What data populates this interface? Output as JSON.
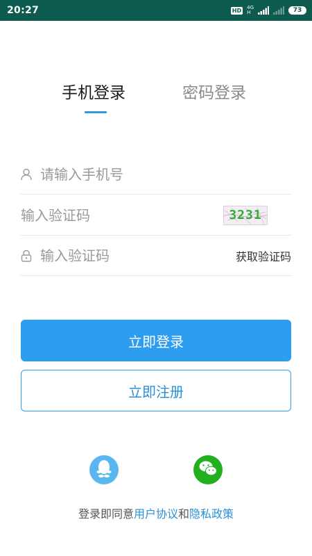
{
  "status_bar": {
    "time": "20:27",
    "hd_badge": "HD",
    "network_top": "4G",
    "network_bottom": "H",
    "battery": "73"
  },
  "tabs": [
    {
      "label": "手机登录",
      "active": true
    },
    {
      "label": "密码登录",
      "active": false
    }
  ],
  "form": {
    "phone_placeholder": "请输入手机号",
    "captcha_placeholder": "输入验证码",
    "captcha_code": "3231",
    "sms_placeholder": "输入验证码",
    "get_code_label": "获取验证码"
  },
  "buttons": {
    "login": "立即登录",
    "register": "立即注册"
  },
  "social": {
    "qq_icon": "qq-icon",
    "wechat_icon": "wechat-icon"
  },
  "agreement": {
    "prefix": "登录即同意",
    "user_agreement": "用户协议",
    "and": "和",
    "privacy_policy": "隐私政策"
  },
  "colors": {
    "status_bar": "#0d5a4f",
    "accent": "#2d9df0",
    "qq": "#5ab6f0",
    "wechat": "#22b020",
    "captcha_text": "#2fae2f"
  }
}
